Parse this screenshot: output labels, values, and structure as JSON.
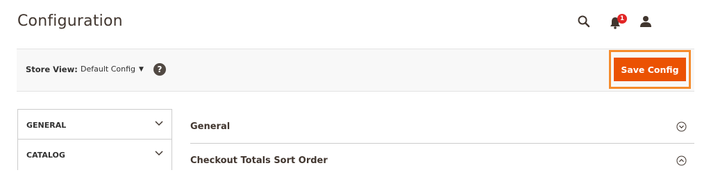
{
  "page": {
    "title": "Configuration"
  },
  "header": {
    "notification_count": "1"
  },
  "toolbar": {
    "store_view_label": "Store View:",
    "store_view_value": "Default Config",
    "help": "?",
    "save_label": "Save Config"
  },
  "sidebar": {
    "items": [
      {
        "label": "GENERAL",
        "icon": "chevron-down-icon"
      },
      {
        "label": "CATALOG",
        "icon": "chevron-down-icon"
      }
    ]
  },
  "main": {
    "sections": [
      {
        "title": "General",
        "icon": "chevron-circle-down-icon"
      },
      {
        "title": "Checkout Totals Sort Order",
        "icon": "chevron-circle-up-icon"
      }
    ]
  },
  "colors": {
    "accent": "#eb5202",
    "highlight": "#f58b2b",
    "badge": "#e22626",
    "dark": "#41362f"
  }
}
